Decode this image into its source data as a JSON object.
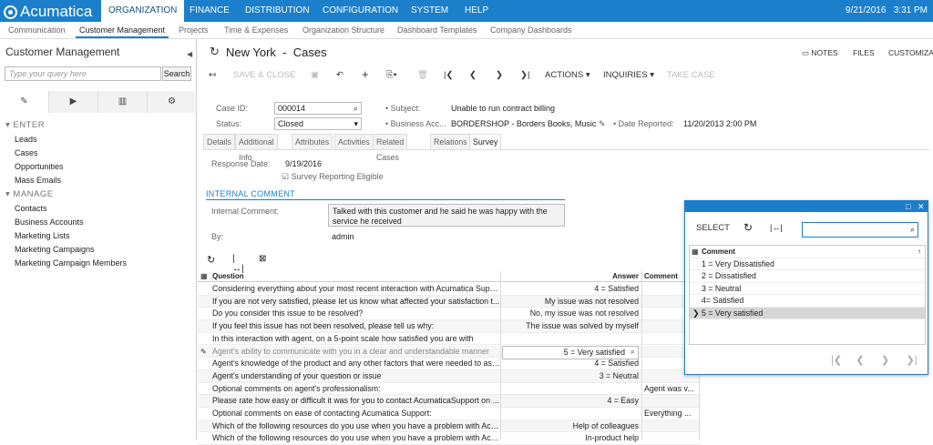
{
  "topbar": {
    "logo": "Acumatica",
    "nav": [
      "ORGANIZATION",
      "FINANCE",
      "DISTRIBUTION",
      "CONFIGURATION",
      "SYSTEM",
      "HELP"
    ],
    "date": "9/21/2016",
    "time": "3:31 PM"
  },
  "subnav": [
    "Communication",
    "Customer Management",
    "Projects",
    "Time & Expenses",
    "Organization Structure",
    "Dashboard Templates",
    "Company Dashboards"
  ],
  "sidebar": {
    "title": "Customer Management",
    "search_placeholder": "Type your query here",
    "search_button": "Search",
    "sections": [
      {
        "label": "ENTER",
        "items": [
          "Leads",
          "Cases",
          "Opportunities",
          "Mass Emails"
        ]
      },
      {
        "label": "MANAGE",
        "items": [
          "Contacts",
          "Business Accounts",
          "Marketing Lists",
          "Marketing Campaigns",
          "Marketing Campaign Members"
        ]
      }
    ]
  },
  "header": {
    "breadcrumb_1": "New York",
    "separator": "-",
    "title": "Cases",
    "notes": "NOTES",
    "files": "FILES",
    "customization": "CUSTOMIZAT"
  },
  "toolbar": {
    "save_close": "SAVE & CLOSE",
    "actions": "ACTIONS",
    "inquiries": "INQUIRIES",
    "take_case": "TAKE CASE"
  },
  "form": {
    "case_id_label": "Case ID:",
    "case_id": "000014",
    "status_label": "Status:",
    "status": "Closed",
    "subject_label": "Subject:",
    "subject": "Unable to run contract billing",
    "bacct_label": "Business Acc...",
    "bacct": "BORDERSHOP - Borders Books, Music",
    "reported_label": "Date Reported:",
    "reported": "11/20/2013 2:00 PM"
  },
  "tabs": [
    "Details",
    "Additional Info",
    "Attributes",
    "Activities",
    "Related Cases",
    "Relations",
    "Survey"
  ],
  "survey": {
    "response_date_label": "Response Date:",
    "response_date": "9/19/2016",
    "eligible_label": "Survey Reporting Eligible",
    "section_title": "INTERNAL COMMENT",
    "comment_label": "Internal Comment:",
    "comment": "Talked with this customer and he said he was happy with the service he received",
    "by_label": "By:",
    "by": "admin"
  },
  "grid": {
    "headers": {
      "question": "Question",
      "answer": "Answer",
      "comment": "Comment"
    },
    "rows": [
      {
        "q": "Considering everything about your most recent interaction with Acumatica Supp...",
        "a": "4 = Satisfied",
        "c": ""
      },
      {
        "q": "If you are not very satisfied, please let us know what affected your satisfaction t...",
        "a": "My issue was not resolved",
        "c": ""
      },
      {
        "q": "Do you consider this issue to be resolved?",
        "a": "No, my issue was not resolved",
        "c": ""
      },
      {
        "q": "If you feel this issue has not been resolved, please tell us why:",
        "a": "The issue was solved by myself",
        "c": ""
      },
      {
        "q": "In this interaction with agent, on a 5-point scale how satisfied you are with",
        "a": "",
        "c": ""
      },
      {
        "q": "Agent's ability to communicate with you in a clear and understandable manner",
        "a": "5 = Very satisfied",
        "c": ""
      },
      {
        "q": "Agent's knowledge of the product and any other factors that were needed to ass...",
        "a": "4 = Satisfied",
        "c": ""
      },
      {
        "q": "Agent's understanding of your question or issue",
        "a": "3 = Neutral",
        "c": ""
      },
      {
        "q": "Optional comments on agent's professionalism:",
        "a": "",
        "c": "Agent was v..."
      },
      {
        "q": "Please rate how easy or difficult it was for you to contact AcumaticaSupport on ...",
        "a": "4 = Easy",
        "c": ""
      },
      {
        "q": "Optional comments on ease of contacting Acumatica Support:",
        "a": "",
        "c": "Everything ..."
      },
      {
        "q": "Which of the following resources do you use when you have a problem with Acu...",
        "a": "Help of colleagues",
        "c": ""
      },
      {
        "q": "Which of the following resources do you use when you have a problem with Acu...",
        "a": "In-product help",
        "c": ""
      }
    ]
  },
  "popup": {
    "select": "SELECT",
    "column": "Comment",
    "options": [
      "1 = Very Dissatisfied",
      "2 = Dissatisfied",
      "3 = Neutral",
      "4= Satisfied",
      "5 = Very satisfied"
    ],
    "selected_index": 4
  },
  "colors": {
    "accent": "#1b7fcc"
  }
}
